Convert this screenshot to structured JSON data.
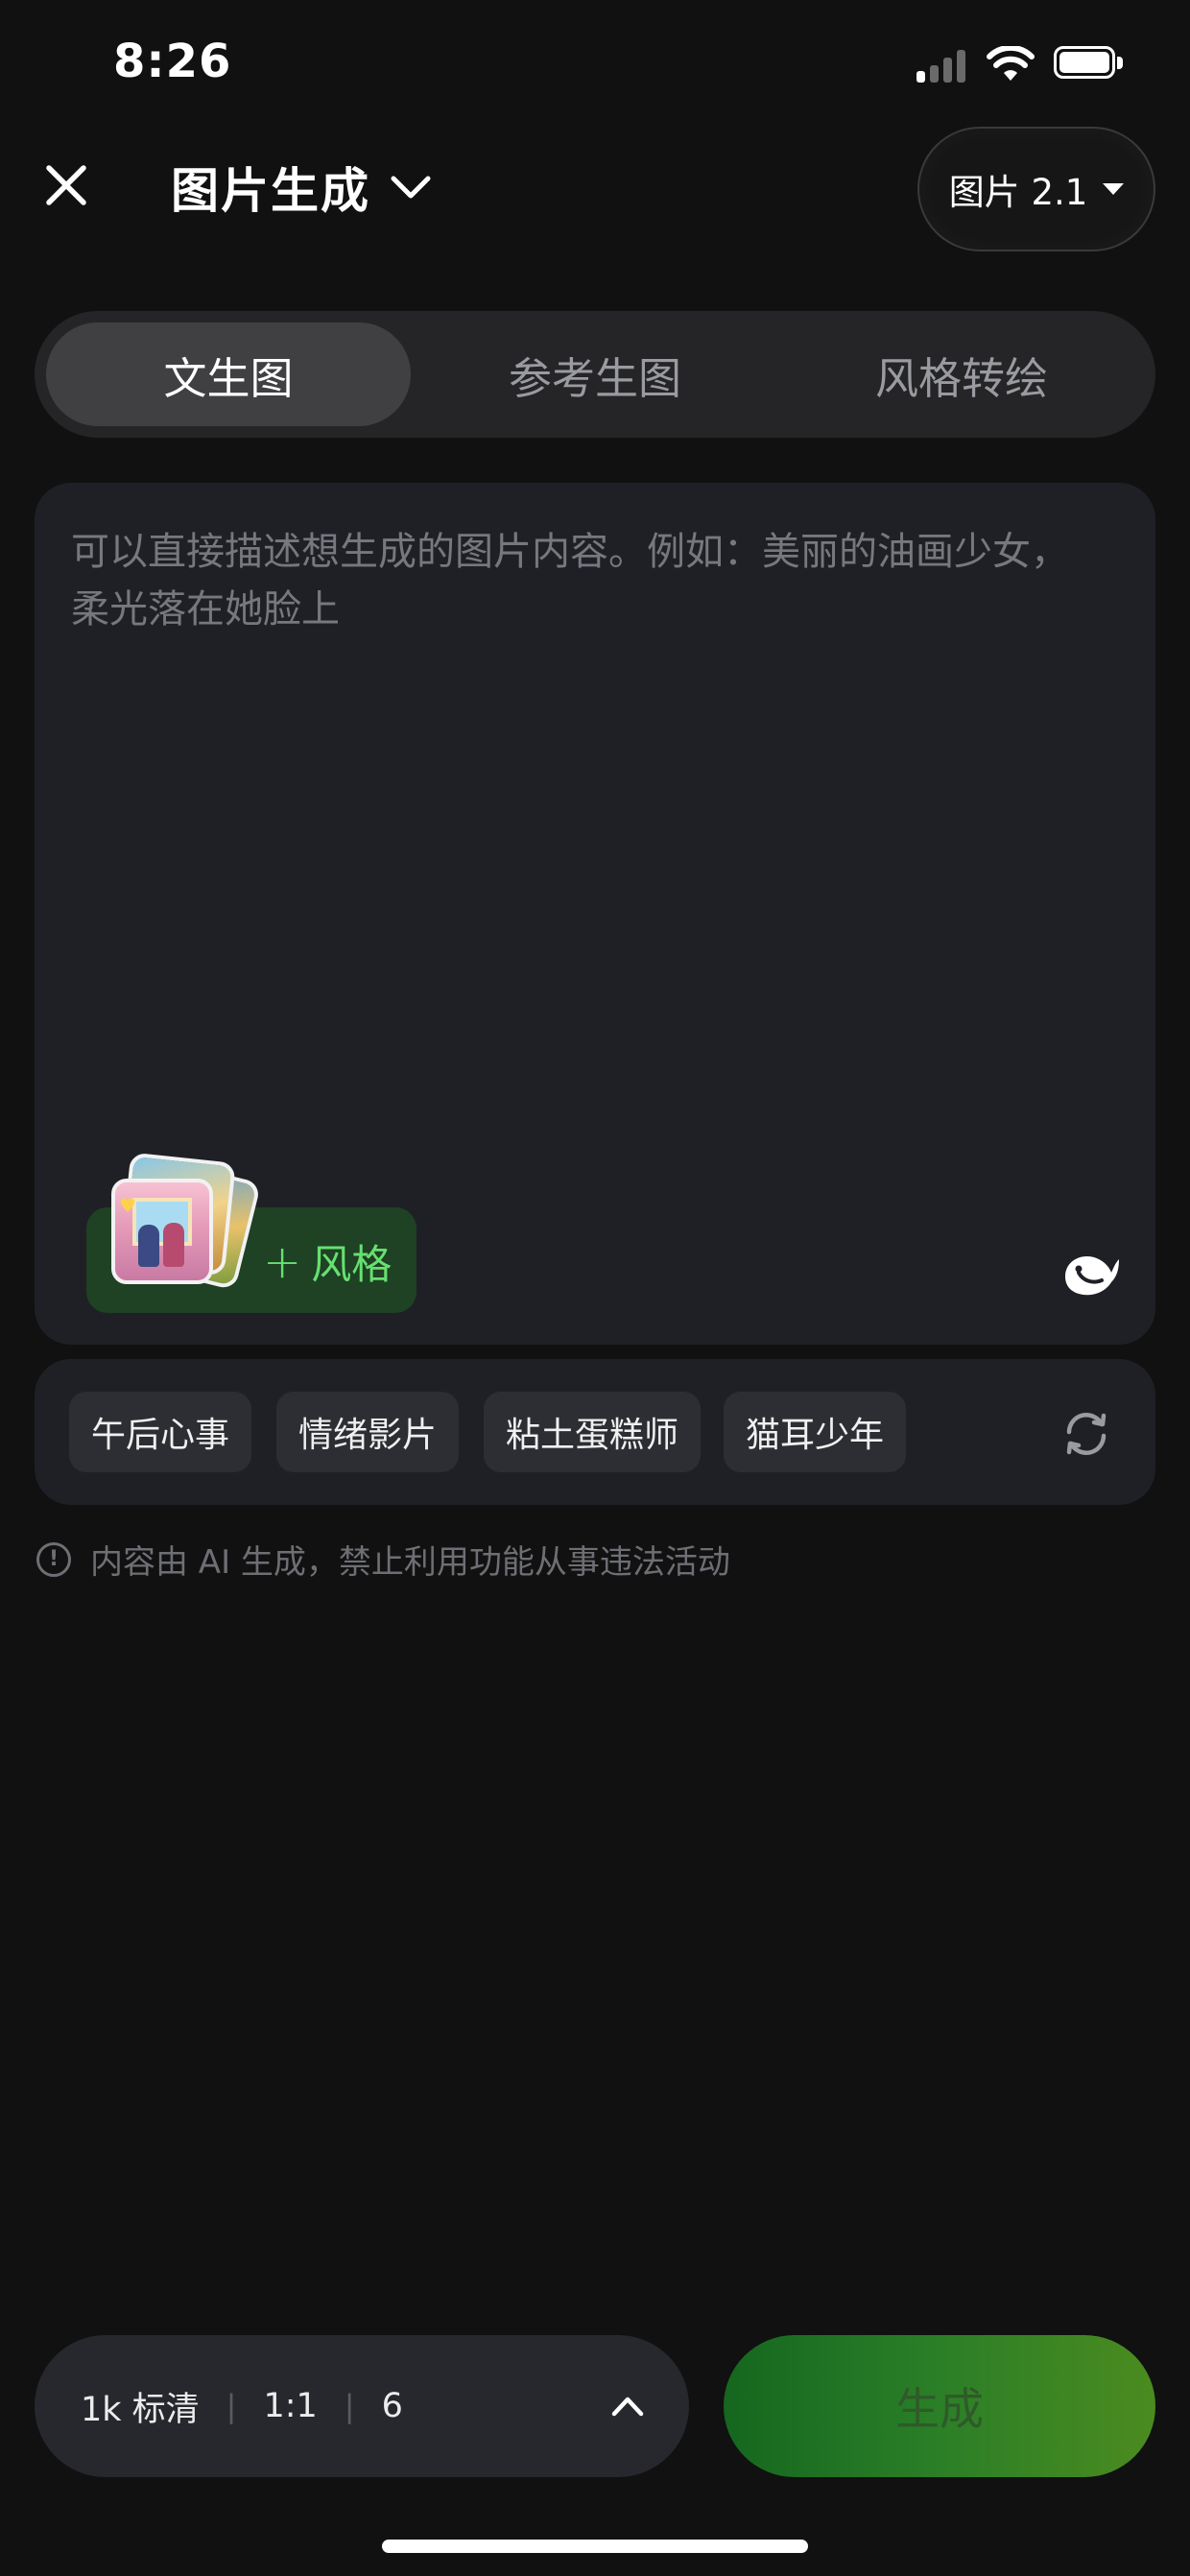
{
  "status": {
    "time": "8:26"
  },
  "header": {
    "title": "图片生成",
    "model_label": "图片 2.1"
  },
  "tabs": [
    {
      "label": "文生图",
      "active": true
    },
    {
      "label": "参考生图",
      "active": false
    },
    {
      "label": "风格转绘",
      "active": false
    }
  ],
  "prompt": {
    "placeholder": "可以直接描述想生成的图片内容。例如：美丽的油画少女，柔光落在她脸上",
    "style_button_label": "风格"
  },
  "suggestions": [
    "午后心事",
    "情绪影片",
    "粘土蛋糕师",
    "猫耳少年"
  ],
  "notice": "内容由 AI 生成，禁止利用功能从事违法活动",
  "settings": {
    "resolution": "1k 标清",
    "ratio": "1:1",
    "count": "6"
  },
  "generate_label": "生成",
  "colors": {
    "background": "#111111",
    "accent_green": "#66e070",
    "generate_gradient_start": "#15671f",
    "generate_gradient_end": "#4b8b1f"
  }
}
